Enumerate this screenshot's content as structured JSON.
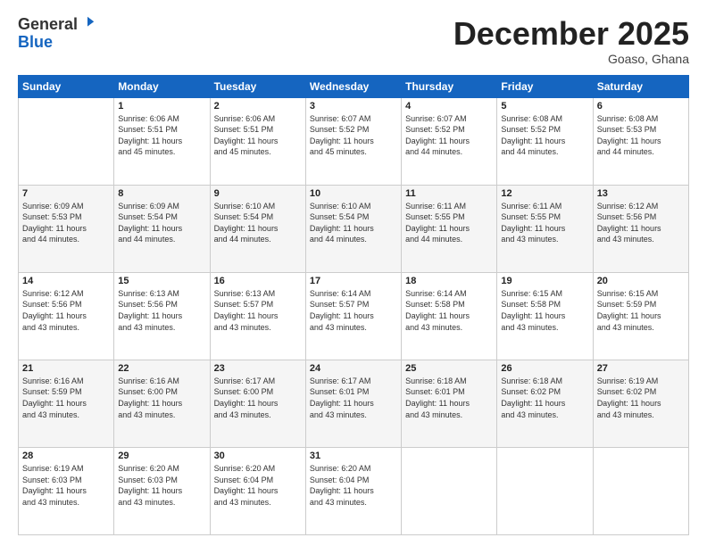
{
  "header": {
    "logo_general": "General",
    "logo_blue": "Blue",
    "month_title": "December 2025",
    "location": "Goaso, Ghana"
  },
  "calendar": {
    "days_of_week": [
      "Sunday",
      "Monday",
      "Tuesday",
      "Wednesday",
      "Thursday",
      "Friday",
      "Saturday"
    ],
    "weeks": [
      [
        {
          "day": "",
          "info": ""
        },
        {
          "day": "1",
          "info": "Sunrise: 6:06 AM\nSunset: 5:51 PM\nDaylight: 11 hours\nand 45 minutes."
        },
        {
          "day": "2",
          "info": "Sunrise: 6:06 AM\nSunset: 5:51 PM\nDaylight: 11 hours\nand 45 minutes."
        },
        {
          "day": "3",
          "info": "Sunrise: 6:07 AM\nSunset: 5:52 PM\nDaylight: 11 hours\nand 45 minutes."
        },
        {
          "day": "4",
          "info": "Sunrise: 6:07 AM\nSunset: 5:52 PM\nDaylight: 11 hours\nand 44 minutes."
        },
        {
          "day": "5",
          "info": "Sunrise: 6:08 AM\nSunset: 5:52 PM\nDaylight: 11 hours\nand 44 minutes."
        },
        {
          "day": "6",
          "info": "Sunrise: 6:08 AM\nSunset: 5:53 PM\nDaylight: 11 hours\nand 44 minutes."
        }
      ],
      [
        {
          "day": "7",
          "info": "Sunrise: 6:09 AM\nSunset: 5:53 PM\nDaylight: 11 hours\nand 44 minutes."
        },
        {
          "day": "8",
          "info": "Sunrise: 6:09 AM\nSunset: 5:54 PM\nDaylight: 11 hours\nand 44 minutes."
        },
        {
          "day": "9",
          "info": "Sunrise: 6:10 AM\nSunset: 5:54 PM\nDaylight: 11 hours\nand 44 minutes."
        },
        {
          "day": "10",
          "info": "Sunrise: 6:10 AM\nSunset: 5:54 PM\nDaylight: 11 hours\nand 44 minutes."
        },
        {
          "day": "11",
          "info": "Sunrise: 6:11 AM\nSunset: 5:55 PM\nDaylight: 11 hours\nand 44 minutes."
        },
        {
          "day": "12",
          "info": "Sunrise: 6:11 AM\nSunset: 5:55 PM\nDaylight: 11 hours\nand 43 minutes."
        },
        {
          "day": "13",
          "info": "Sunrise: 6:12 AM\nSunset: 5:56 PM\nDaylight: 11 hours\nand 43 minutes."
        }
      ],
      [
        {
          "day": "14",
          "info": "Sunrise: 6:12 AM\nSunset: 5:56 PM\nDaylight: 11 hours\nand 43 minutes."
        },
        {
          "day": "15",
          "info": "Sunrise: 6:13 AM\nSunset: 5:56 PM\nDaylight: 11 hours\nand 43 minutes."
        },
        {
          "day": "16",
          "info": "Sunrise: 6:13 AM\nSunset: 5:57 PM\nDaylight: 11 hours\nand 43 minutes."
        },
        {
          "day": "17",
          "info": "Sunrise: 6:14 AM\nSunset: 5:57 PM\nDaylight: 11 hours\nand 43 minutes."
        },
        {
          "day": "18",
          "info": "Sunrise: 6:14 AM\nSunset: 5:58 PM\nDaylight: 11 hours\nand 43 minutes."
        },
        {
          "day": "19",
          "info": "Sunrise: 6:15 AM\nSunset: 5:58 PM\nDaylight: 11 hours\nand 43 minutes."
        },
        {
          "day": "20",
          "info": "Sunrise: 6:15 AM\nSunset: 5:59 PM\nDaylight: 11 hours\nand 43 minutes."
        }
      ],
      [
        {
          "day": "21",
          "info": "Sunrise: 6:16 AM\nSunset: 5:59 PM\nDaylight: 11 hours\nand 43 minutes."
        },
        {
          "day": "22",
          "info": "Sunrise: 6:16 AM\nSunset: 6:00 PM\nDaylight: 11 hours\nand 43 minutes."
        },
        {
          "day": "23",
          "info": "Sunrise: 6:17 AM\nSunset: 6:00 PM\nDaylight: 11 hours\nand 43 minutes."
        },
        {
          "day": "24",
          "info": "Sunrise: 6:17 AM\nSunset: 6:01 PM\nDaylight: 11 hours\nand 43 minutes."
        },
        {
          "day": "25",
          "info": "Sunrise: 6:18 AM\nSunset: 6:01 PM\nDaylight: 11 hours\nand 43 minutes."
        },
        {
          "day": "26",
          "info": "Sunrise: 6:18 AM\nSunset: 6:02 PM\nDaylight: 11 hours\nand 43 minutes."
        },
        {
          "day": "27",
          "info": "Sunrise: 6:19 AM\nSunset: 6:02 PM\nDaylight: 11 hours\nand 43 minutes."
        }
      ],
      [
        {
          "day": "28",
          "info": "Sunrise: 6:19 AM\nSunset: 6:03 PM\nDaylight: 11 hours\nand 43 minutes."
        },
        {
          "day": "29",
          "info": "Sunrise: 6:20 AM\nSunset: 6:03 PM\nDaylight: 11 hours\nand 43 minutes."
        },
        {
          "day": "30",
          "info": "Sunrise: 6:20 AM\nSunset: 6:04 PM\nDaylight: 11 hours\nand 43 minutes."
        },
        {
          "day": "31",
          "info": "Sunrise: 6:20 AM\nSunset: 6:04 PM\nDaylight: 11 hours\nand 43 minutes."
        },
        {
          "day": "",
          "info": ""
        },
        {
          "day": "",
          "info": ""
        },
        {
          "day": "",
          "info": ""
        }
      ]
    ]
  }
}
